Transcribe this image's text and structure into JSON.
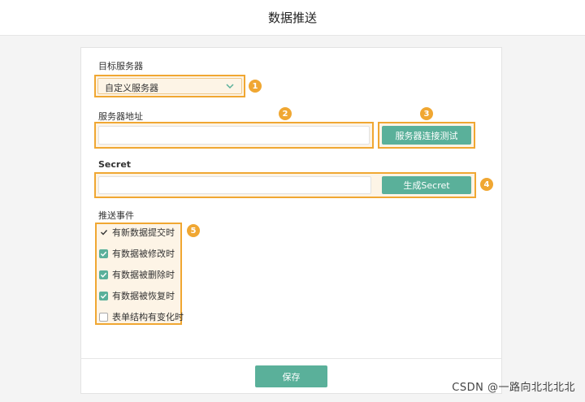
{
  "header": {
    "title": "数据推送"
  },
  "target_server": {
    "label": "目标服务器",
    "selected": "自定义服务器",
    "callout": "1"
  },
  "server_address": {
    "label": "服务器地址",
    "value": "",
    "callout": "2",
    "test_button": "服务器连接测试",
    "test_callout": "3"
  },
  "secret": {
    "label": "Secret",
    "value": "",
    "generate_button": "生成Secret",
    "callout": "4"
  },
  "push_events": {
    "label": "推送事件",
    "callout": "5",
    "items": [
      {
        "label": "有新数据提交时",
        "state": "checkmark"
      },
      {
        "label": "有数据被修改时",
        "state": "checked"
      },
      {
        "label": "有数据被删除时",
        "state": "checked"
      },
      {
        "label": "有数据被恢复时",
        "state": "checked"
      },
      {
        "label": "表单结构有变化时",
        "state": "unchecked"
      }
    ]
  },
  "footer": {
    "save_button": "保存"
  },
  "watermark": "CSDN @一路向北北北北",
  "colors": {
    "accent": "#5ab09a",
    "highlight": "#f0a732"
  }
}
